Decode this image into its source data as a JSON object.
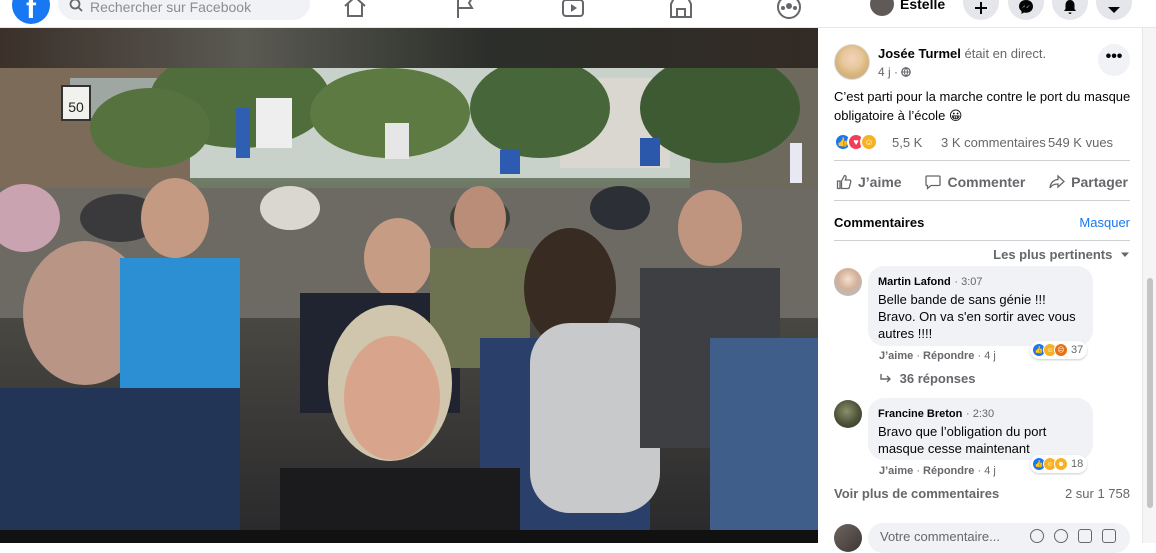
{
  "topbar": {
    "logo_letter": "f",
    "search_placeholder": "Rechercher sur Facebook",
    "profile_name": "Estelle"
  },
  "post": {
    "author_name": "Josée Turmel",
    "author_status": "était en direct.",
    "time": "4 j",
    "more_label": "•••",
    "text": "C’est parti pour la marche contre le port du masque obligatoire à l’école 😀",
    "reaction_count": "5,5 K",
    "comment_count": "3 K commentaires",
    "view_count": "549 K vues"
  },
  "actions": {
    "like": "J’aime",
    "comment": "Commenter",
    "share": "Partager"
  },
  "comments": {
    "title": "Commentaires",
    "hide_label": "Masquer",
    "sort_label": "Les plus pertinents",
    "items": [
      {
        "author": "Martin Lafond",
        "time": "3:07",
        "text": "Belle bande de sans génie !!! Bravo. On va s'en sortir avec vous autres !!!!",
        "like": "J’aime",
        "reply": "Répondre",
        "age": "4 j",
        "reaction_count": "37",
        "replies_label": "36 réponses"
      },
      {
        "author": "Francine Breton",
        "time": "2:30",
        "text": "Bravo que l’obligation du port masque cesse maintenant",
        "like": "J’aime",
        "reply": "Répondre",
        "age": "4 j",
        "reaction_count": "18"
      }
    ],
    "more_label": "Voir plus de commentaires",
    "position_label": "2 sur 1 758",
    "compose_placeholder": "Votre commentaire..."
  },
  "video": {
    "sign_text": "50"
  },
  "colors": {
    "brand": "#1877f2",
    "link": "#1877f2",
    "muted": "#65676b",
    "bubble": "#f0f2f5"
  }
}
